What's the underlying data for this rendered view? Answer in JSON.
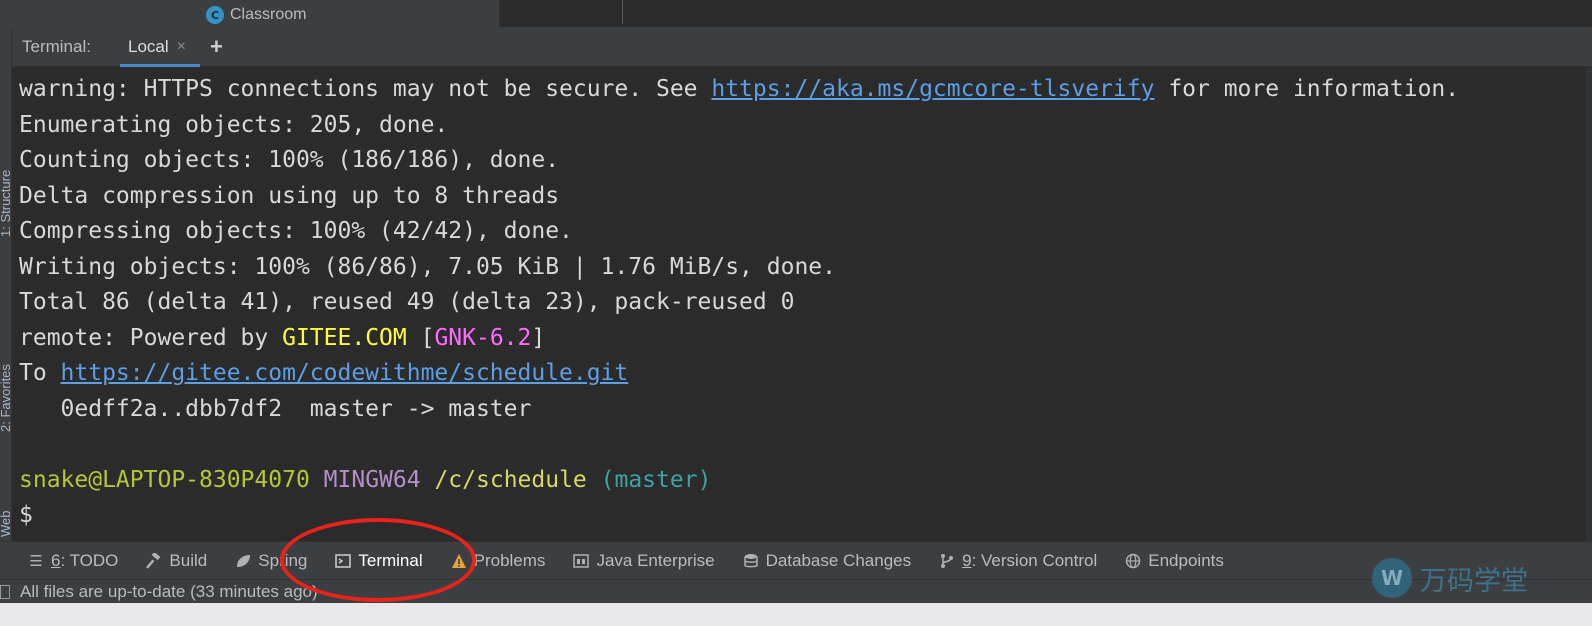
{
  "project_tree": {
    "item_label": "Classroom",
    "item_icon": "class-icon",
    "icon_letter": "C"
  },
  "left_stripe": {
    "tabs": [
      "1: Structure",
      "2: Favorites",
      "Web"
    ]
  },
  "terminal": {
    "title": "Terminal:",
    "tab_label": "Local",
    "close_glyph": "×",
    "add_glyph": "+",
    "lines": {
      "l1_a": "warning: HTTPS connections may not be secure. See ",
      "l1_link": "https://aka.ms/gcmcore-tlsverify",
      "l1_b": " for more information.",
      "l2": "Enumerating objects: 205, done.",
      "l3": "Counting objects: 100% (186/186), done.",
      "l4": "Delta compression using up to 8 threads",
      "l5": "Compressing objects: 100% (42/42), done.",
      "l6": "Writing objects: 100% (86/86), 7.05 KiB | 1.76 MiB/s, done.",
      "l7": "Total 86 (delta 41), reused 49 (delta 23), pack-reused 0",
      "l8_a": "remote: Powered by ",
      "l8_gitee": "GITEE.COM",
      "l8_b": " [",
      "l8_gnk": "GNK-6.2",
      "l8_c": "]",
      "l9_a": "To ",
      "l9_link": "https://gitee.com/codewithme/schedule.git",
      "l10": "   0edff2a..dbb7df2  master -> master",
      "prompt_user": "snake@LAPTOP-830P4070",
      "prompt_env": "MINGW64",
      "prompt_path": "/c/schedule",
      "prompt_branch": "(master)",
      "prompt_symbol": "$"
    }
  },
  "toolbar": {
    "items": [
      {
        "num": "6",
        "label": ": TODO",
        "icon": "list-icon"
      },
      {
        "label": "Build",
        "icon": "hammer-icon"
      },
      {
        "label": "Spring",
        "icon": "spring-leaf-icon"
      },
      {
        "label": "Terminal",
        "icon": "terminal-icon"
      },
      {
        "label": "Problems",
        "icon": "warning-icon"
      },
      {
        "label": "Java Enterprise",
        "icon": "java-enterprise-icon"
      },
      {
        "label": "Database Changes",
        "icon": "database-icon"
      },
      {
        "num": "9",
        "label": ": Version Control",
        "icon": "version-control-icon"
      },
      {
        "label": "Endpoints",
        "icon": "globe-icon"
      }
    ]
  },
  "status": {
    "message": "All files are up-to-date (33 minutes ago)"
  },
  "watermark": {
    "text": "万码学堂"
  },
  "colors": {
    "accent": "#4a88c7",
    "annotation": "#e8231b"
  }
}
